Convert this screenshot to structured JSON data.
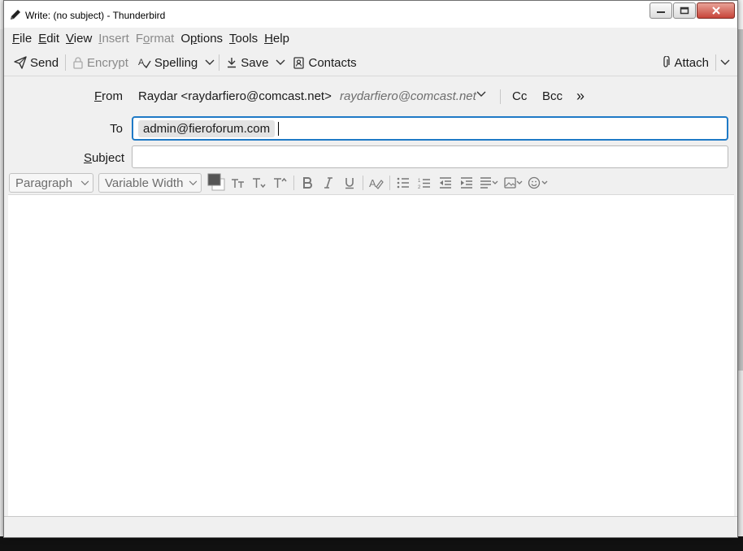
{
  "window": {
    "title": "Write: (no subject) - Thunderbird"
  },
  "menubar": {
    "items": [
      {
        "label": "File",
        "mnemonic": "F",
        "rest": "ile",
        "enabled": true
      },
      {
        "label": "Edit",
        "mnemonic": "E",
        "rest": "dit",
        "enabled": true
      },
      {
        "label": "View",
        "mnemonic": "V",
        "rest": "iew",
        "enabled": true
      },
      {
        "label": "Insert",
        "mnemonic": "I",
        "rest": "nsert",
        "enabled": false
      },
      {
        "label": "Format",
        "mnemonic": "o",
        "pre": "F",
        "rest": "rmat",
        "enabled": false
      },
      {
        "label": "Options",
        "mnemonic": "p",
        "pre": "O",
        "rest": "tions",
        "enabled": true
      },
      {
        "label": "Tools",
        "mnemonic": "T",
        "rest": "ools",
        "enabled": true
      },
      {
        "label": "Help",
        "mnemonic": "H",
        "rest": "elp",
        "enabled": true
      }
    ]
  },
  "toolbar": {
    "send": "Send",
    "encrypt": "Encrypt",
    "spelling": "Spelling",
    "save": "Save",
    "contacts": "Contacts",
    "attach": "Attach"
  },
  "header": {
    "from_label": "From",
    "from_value": "Raydar <raydarfiero@comcast.net>",
    "from_alt": "raydarfiero@comcast.net",
    "cc": "Cc",
    "bcc": "Bcc",
    "more": "»",
    "to_label": "To",
    "to_recipient": "admin@fieroforum.com",
    "subject_label": "Subject",
    "subject_value": ""
  },
  "format": {
    "paragraph": "Paragraph",
    "font": "Variable Width",
    "text_color": "#555555",
    "bg_color": "#ffffff"
  },
  "colors": {
    "focus": "#1f7ac6"
  }
}
